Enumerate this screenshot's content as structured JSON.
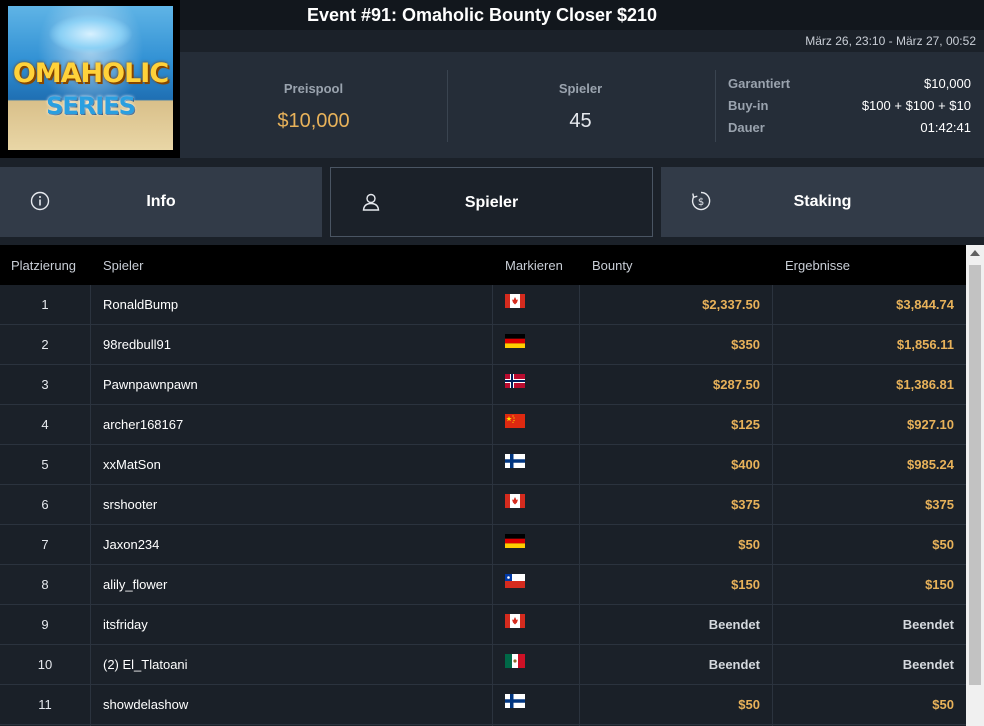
{
  "header": {
    "logo_line1": "OMAHOLIC",
    "logo_line2": "SERIES",
    "event_title": "Event #91: Omaholic Bounty Closer $210",
    "date_range": "März 26, 23:10 - März 27, 00:52"
  },
  "stats": {
    "prizepool_label": "Preispool",
    "prizepool_value": "$10,000",
    "players_label": "Spieler",
    "players_value": "45",
    "details": [
      {
        "label": "Garantiert",
        "value": "$10,000"
      },
      {
        "label": "Buy-in",
        "value": "$100 + $100 + $10"
      },
      {
        "label": "Dauer",
        "value": "01:42:41"
      }
    ]
  },
  "tabs": [
    {
      "label": "Info",
      "icon": "info-circle-icon",
      "active": false
    },
    {
      "label": "Spieler",
      "icon": "user-icon",
      "active": true
    },
    {
      "label": "Staking",
      "icon": "dollar-cycle-icon",
      "active": false
    }
  ],
  "table": {
    "columns": {
      "place": "Platzierung",
      "player": "Spieler",
      "flag": "Markieren",
      "bounty": "Bounty",
      "results": "Ergebnisse"
    },
    "rows": [
      {
        "place": "1",
        "player": "RonaldBump",
        "flag": "canada-flag-icon",
        "bounty": "$2,337.50",
        "result": "$3,844.74"
      },
      {
        "place": "2",
        "player": "98redbull91",
        "flag": "germany-flag-icon",
        "bounty": "$350",
        "result": "$1,856.11"
      },
      {
        "place": "3",
        "player": "Pawnpawnpawn",
        "flag": "norway-flag-icon",
        "bounty": "$287.50",
        "result": "$1,386.81"
      },
      {
        "place": "4",
        "player": "archer168167",
        "flag": "china-flag-icon",
        "bounty": "$125",
        "result": "$927.10"
      },
      {
        "place": "5",
        "player": "xxMatSon",
        "flag": "finland-flag-icon",
        "bounty": "$400",
        "result": "$985.24"
      },
      {
        "place": "6",
        "player": "srshooter",
        "flag": "canada-flag-icon",
        "bounty": "$375",
        "result": "$375"
      },
      {
        "place": "7",
        "player": "Jaxon234",
        "flag": "germany-flag-icon",
        "bounty": "$50",
        "result": "$50"
      },
      {
        "place": "8",
        "player": "alily_flower",
        "flag": "chile-flag-icon",
        "bounty": "$150",
        "result": "$150"
      },
      {
        "place": "9",
        "player": "itsfriday",
        "flag": "canada-flag-icon",
        "bounty": "Beendet",
        "result": "Beendet"
      },
      {
        "place": "10",
        "player": "(2) El_Tlatoani",
        "flag": "mexico-flag-icon",
        "bounty": "Beendet",
        "result": "Beendet"
      },
      {
        "place": "11",
        "player": "showdelashow",
        "flag": "finland-flag-icon",
        "bounty": "$50",
        "result": "$50"
      }
    ]
  },
  "colors": {
    "gold": "#e8b25a",
    "background": "#1b2129",
    "panel": "#252d38",
    "tab": "#323b48"
  }
}
